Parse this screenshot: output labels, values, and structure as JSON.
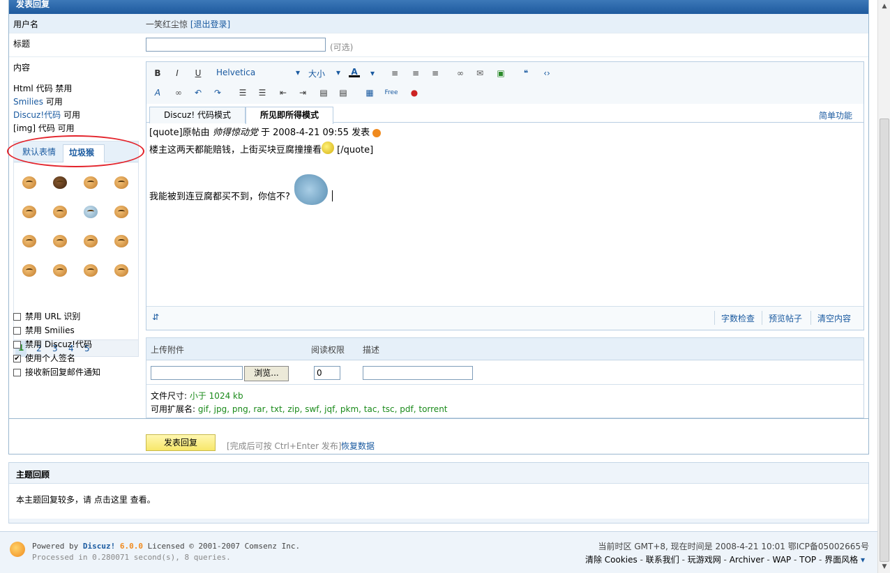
{
  "header": {
    "title": "发表回复"
  },
  "user": {
    "label": "用户名",
    "name": "一笑红尘惊",
    "logout": "[退出登录]"
  },
  "title_row": {
    "label": "标题",
    "value": "",
    "optional": "(可选)"
  },
  "content": {
    "label": "内容",
    "perms": [
      {
        "name": "Html 代码",
        "state": "禁用"
      },
      {
        "name": "Smilies",
        "state": "可用"
      },
      {
        "name": "Discuz!代码",
        "state": "可用"
      },
      {
        "name": "[img] 代码",
        "state": "可用"
      }
    ]
  },
  "smilies": {
    "tabs": [
      "默认表情",
      "垃圾猴"
    ],
    "pages": [
      "1",
      "2",
      "3",
      "4",
      "5"
    ],
    "current_page": "1"
  },
  "options": [
    {
      "label": "禁用  URL 识别",
      "checked": false
    },
    {
      "label": "禁用  Smilies",
      "checked": false
    },
    {
      "label": "禁用  Discuz!代码",
      "checked": false
    },
    {
      "label": "使用个人签名",
      "checked": true
    },
    {
      "label": "接收新回复邮件通知",
      "checked": false
    }
  ],
  "editor": {
    "font": "Helvetica",
    "size": "大小",
    "modes": [
      "Discuz! 代码模式",
      "所见即所得模式"
    ],
    "active_mode": "所见即所得模式",
    "simple_link": "简单功能",
    "quote_line": {
      "prefix": "[quote]原帖由 ",
      "author": "帅得惊动党",
      "mid": " 于 2008-4-21 09:55 发表 "
    },
    "line2": "楼主这两天都能赔钱，上街买块豆腐撞撞看",
    "line2_end": " [/quote]",
    "line3": "我能被到连豆腐都买不到，你信不?",
    "footer_links": [
      "字数检查",
      "预览帖子",
      "清空内容"
    ]
  },
  "attachment": {
    "col_upload": "上传附件",
    "col_perm": "阅读权限",
    "col_desc": "描述",
    "browse": "浏览...",
    "perm_value": "0",
    "size_label": "文件尺寸: ",
    "size_value": "小于  1024 kb",
    "ext_label": "可用扩展名: ",
    "ext_value": "gif, jpg, png, rar, txt, zip, swf, jqf, pkm, tac, tsc, pdf, torrent"
  },
  "submit": {
    "button": "发表回复",
    "hint": "[完成后可按  Ctrl+Enter 发布]",
    "restore": "恢复数据"
  },
  "review": {
    "title": "主题回顾",
    "text": "本主题回复较多，请 点击这里 查看。"
  },
  "footer": {
    "powered_prefix": "Powered by ",
    "powered_brand": "Discuz!",
    "powered_version": "6.0.0",
    "powered_suffix": " Licensed © 2001-2007 Comsenz Inc.",
    "processed": "Processed in 0.280071 second(s), 8 queries.",
    "time_info": "当前时区  GMT+8, 现在时间是  2008-4-21 10:01 鄂ICP备05002665号",
    "links": [
      "清除  Cookies",
      "联系我们",
      "玩游戏网",
      "Archiver",
      "WAP",
      "TOP",
      "界面风格"
    ]
  }
}
